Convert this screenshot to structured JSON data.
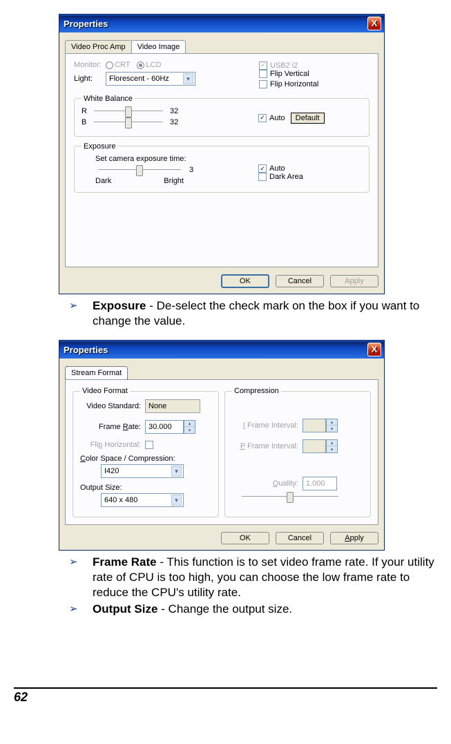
{
  "page_number": "62",
  "dialog1": {
    "title": "Properties",
    "tabs": {
      "video_proc_amp": "Video Proc Amp",
      "video_image": "Video Image"
    },
    "monitor_label": "Monitor:",
    "crt": "CRT",
    "lcd": "LCD",
    "light_label": "Light:",
    "light_value": "Florescent - 60Hz",
    "usb2": "USB2  i2",
    "flip_v": "Flip Vertical",
    "flip_h": "Flip Horizontal",
    "wb_legend": "White Balance",
    "wb_r": "R",
    "wb_b": "B",
    "wb_r_val": "32",
    "wb_b_val": "32",
    "wb_auto": "Auto",
    "default_btn": "Default",
    "exp_legend": "Exposure",
    "exp_text": "Set camera exposure time:",
    "exp_dark": "Dark",
    "exp_bright": "Bright",
    "exp_val": "3",
    "exp_auto": "Auto",
    "exp_darkarea": "Dark Area",
    "ok": "OK",
    "cancel": "Cancel",
    "apply": "Apply"
  },
  "bullet1": {
    "bold": "Exposure",
    "rest": " - De-select the check mark on the box if you want to change the value."
  },
  "dialog2": {
    "title": "Properties",
    "tab_stream": "Stream Format",
    "vf_legend": "Video Format",
    "comp_legend": "Compression",
    "video_standard_label": "Video Standard:",
    "video_standard_value": "None",
    "frame_rate_label_pre": "Frame ",
    "frame_rate_label_u": "R",
    "frame_rate_label_post": "ate:",
    "frame_rate_value": "30.000",
    "flip_h_label_pre": "Fli",
    "flip_h_label_u": "p",
    "flip_h_label_post": " Horizontal:",
    "colorspace_label_u": "C",
    "colorspace_label_post": "olor Space / Compression:",
    "colorspace_value": "I420",
    "outsize_label": "Output Size:",
    "outsize_value": "640 x 480",
    "iframe_label_u": "I",
    "iframe_label_post": " Frame Interval:",
    "pframe_label_u": "P",
    "pframe_label_post": " Frame Interval:",
    "quality_label_u": "Q",
    "quality_label_post": "uality:",
    "quality_value": "1.000",
    "ok": "OK",
    "cancel": "Cancel",
    "apply_u": "A",
    "apply_post": "pply"
  },
  "bullet2": {
    "bold": "Frame Rate",
    "rest": " - This function is to set video frame rate. If your utility rate of CPU is too high, you can choose the low frame rate to reduce the CPU's utility rate."
  },
  "bullet3": {
    "bold": "Output Size",
    "rest": " - Change the output size."
  }
}
